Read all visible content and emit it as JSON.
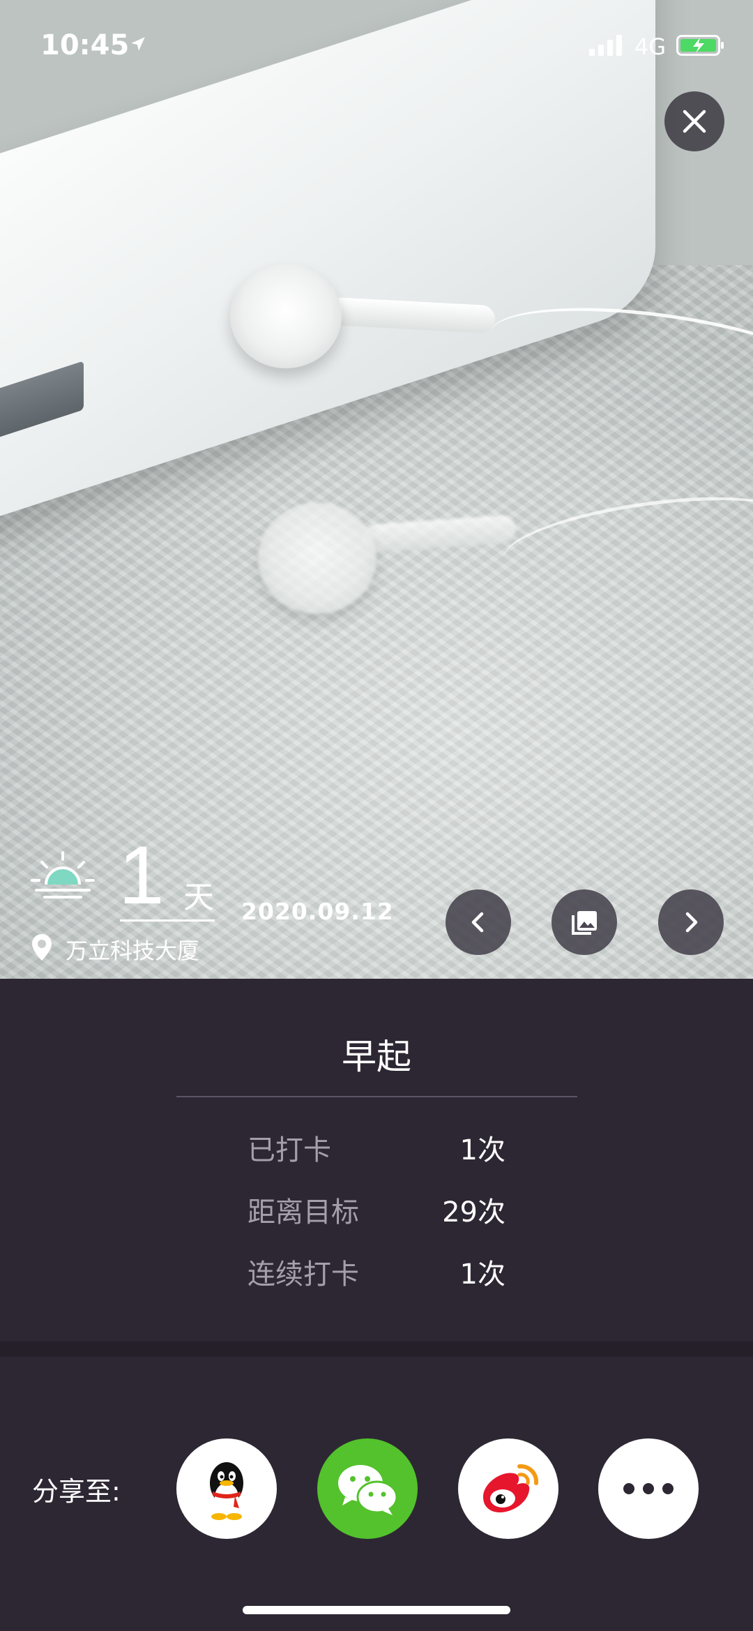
{
  "status_bar": {
    "time": "10:45",
    "network": "4G"
  },
  "hero": {
    "day_count": "1",
    "day_unit": "天",
    "location": "万立科技大厦",
    "date": "2020.09.12",
    "icons": [
      "close-icon",
      "sunrise-icon",
      "location-pin-icon",
      "chevron-left-icon",
      "gallery-icon",
      "chevron-right-icon"
    ]
  },
  "task": {
    "title": "早起",
    "stats": [
      {
        "label": "已打卡",
        "value": "1次"
      },
      {
        "label": "距离目标",
        "value": "29次"
      },
      {
        "label": "连续打卡",
        "value": "1次"
      }
    ]
  },
  "share": {
    "label": "分享至:",
    "targets": [
      "qq-icon",
      "wechat-icon",
      "weibo-icon",
      "more-icon"
    ]
  },
  "colors": {
    "panel_bg": "#2d2733",
    "wechat_green": "#53c22c",
    "sun_accent": "#7fd8c2"
  }
}
